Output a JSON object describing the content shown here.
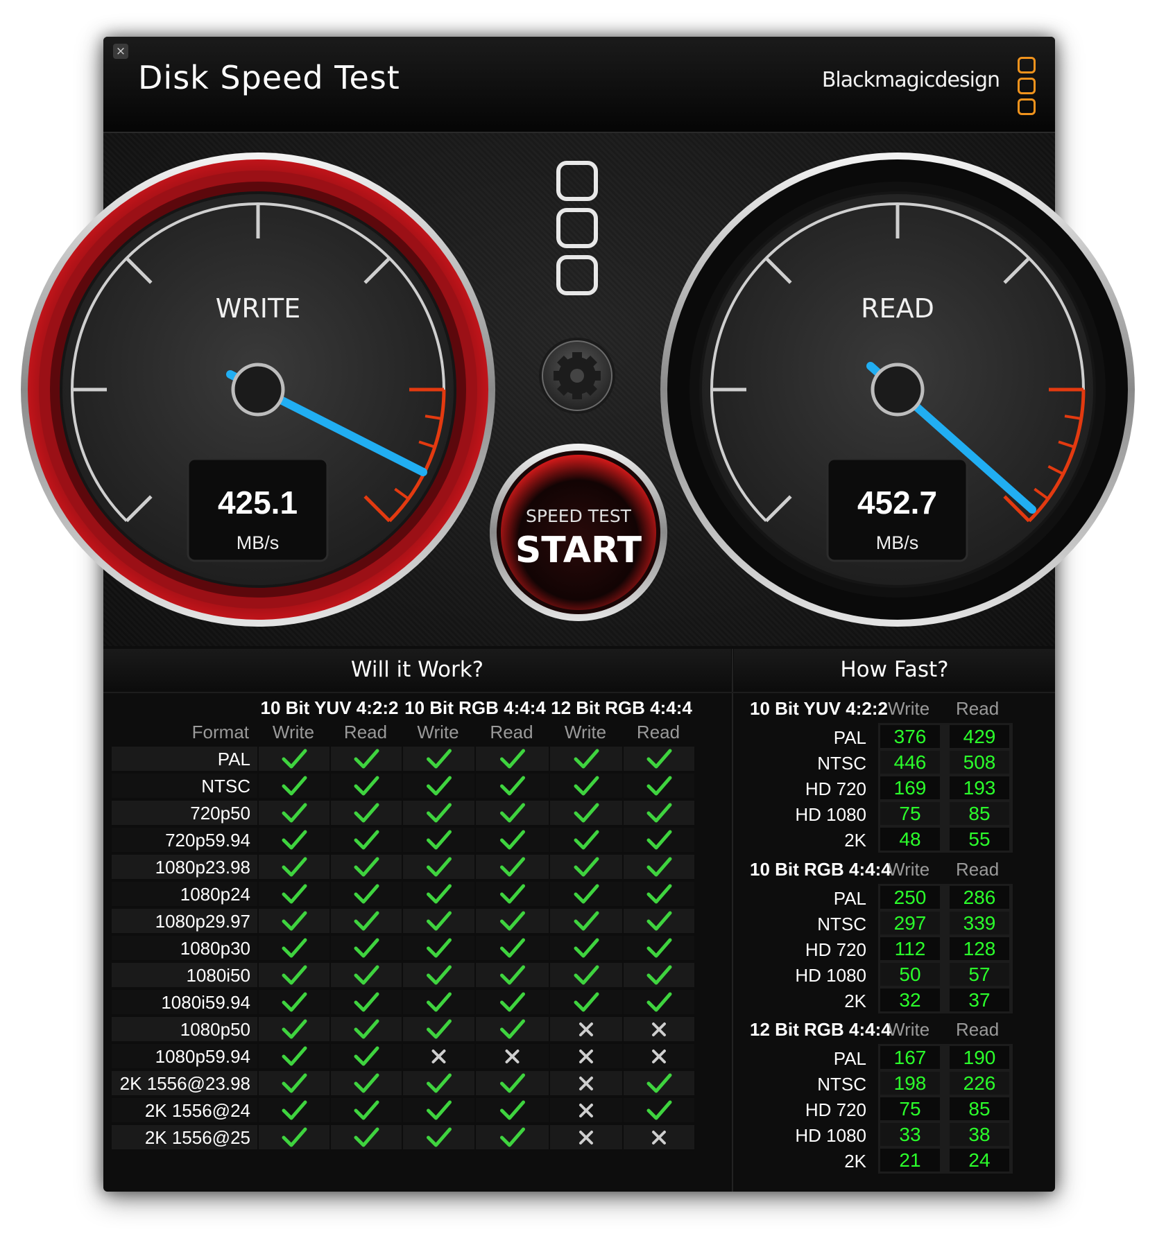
{
  "window": {
    "title": "Disk Speed Test",
    "brand": "Blackmagicdesign",
    "close": "×"
  },
  "colors": {
    "accent_red": "#d0161c",
    "needle_blue": "#21aef2",
    "ok_green": "#2bff2b",
    "logo_orange": "#f0931d"
  },
  "write_gauge": {
    "label": "WRITE",
    "value": "425.1",
    "unit": "MB/s"
  },
  "read_gauge": {
    "label": "READ",
    "value": "452.7",
    "unit": "MB/s"
  },
  "start_button": {
    "line1": "SPEED TEST",
    "line2": "START"
  },
  "settings_icon": "gear-icon",
  "will_it_work": {
    "title": "Will it Work?",
    "format_label": "Format",
    "groups": [
      "10 Bit YUV 4:2:2",
      "10 Bit RGB 4:4:4",
      "12 Bit RGB 4:4:4"
    ],
    "subheaders": [
      "Write",
      "Read",
      "Write",
      "Read",
      "Write",
      "Read"
    ],
    "rows": [
      {
        "format": "PAL",
        "results": [
          1,
          1,
          1,
          1,
          1,
          1
        ]
      },
      {
        "format": "NTSC",
        "results": [
          1,
          1,
          1,
          1,
          1,
          1
        ]
      },
      {
        "format": "720p50",
        "results": [
          1,
          1,
          1,
          1,
          1,
          1
        ]
      },
      {
        "format": "720p59.94",
        "results": [
          1,
          1,
          1,
          1,
          1,
          1
        ]
      },
      {
        "format": "1080p23.98",
        "results": [
          1,
          1,
          1,
          1,
          1,
          1
        ]
      },
      {
        "format": "1080p24",
        "results": [
          1,
          1,
          1,
          1,
          1,
          1
        ]
      },
      {
        "format": "1080p29.97",
        "results": [
          1,
          1,
          1,
          1,
          1,
          1
        ]
      },
      {
        "format": "1080p30",
        "results": [
          1,
          1,
          1,
          1,
          1,
          1
        ]
      },
      {
        "format": "1080i50",
        "results": [
          1,
          1,
          1,
          1,
          1,
          1
        ]
      },
      {
        "format": "1080i59.94",
        "results": [
          1,
          1,
          1,
          1,
          1,
          1
        ]
      },
      {
        "format": "1080p50",
        "results": [
          1,
          1,
          1,
          1,
          0,
          0
        ]
      },
      {
        "format": "1080p59.94",
        "results": [
          1,
          1,
          0,
          0,
          0,
          0
        ]
      },
      {
        "format": "2K 1556@23.98",
        "results": [
          1,
          1,
          1,
          1,
          0,
          1
        ]
      },
      {
        "format": "2K 1556@24",
        "results": [
          1,
          1,
          1,
          1,
          0,
          1
        ]
      },
      {
        "format": "2K 1556@25",
        "results": [
          1,
          1,
          1,
          1,
          0,
          0
        ]
      }
    ]
  },
  "how_fast": {
    "title": "How Fast?",
    "groups": [
      {
        "name": "10 Bit YUV 4:2:2",
        "write": "Write",
        "read": "Read",
        "rows": [
          {
            "label": "PAL",
            "write": "376",
            "read": "429"
          },
          {
            "label": "NTSC",
            "write": "446",
            "read": "508"
          },
          {
            "label": "HD 720",
            "write": "169",
            "read": "193"
          },
          {
            "label": "HD 1080",
            "write": "75",
            "read": "85"
          },
          {
            "label": "2K",
            "write": "48",
            "read": "55"
          }
        ]
      },
      {
        "name": "10 Bit RGB 4:4:4",
        "write": "Write",
        "read": "Read",
        "rows": [
          {
            "label": "PAL",
            "write": "250",
            "read": "286"
          },
          {
            "label": "NTSC",
            "write": "297",
            "read": "339"
          },
          {
            "label": "HD 720",
            "write": "112",
            "read": "128"
          },
          {
            "label": "HD 1080",
            "write": "50",
            "read": "57"
          },
          {
            "label": "2K",
            "write": "32",
            "read": "37"
          }
        ]
      },
      {
        "name": "12 Bit RGB 4:4:4",
        "write": "Write",
        "read": "Read",
        "rows": [
          {
            "label": "PAL",
            "write": "167",
            "read": "190"
          },
          {
            "label": "NTSC",
            "write": "198",
            "read": "226"
          },
          {
            "label": "HD 720",
            "write": "75",
            "read": "85"
          },
          {
            "label": "HD 1080",
            "write": "33",
            "read": "38"
          },
          {
            "label": "2K",
            "write": "21",
            "read": "24"
          }
        ]
      }
    ]
  }
}
